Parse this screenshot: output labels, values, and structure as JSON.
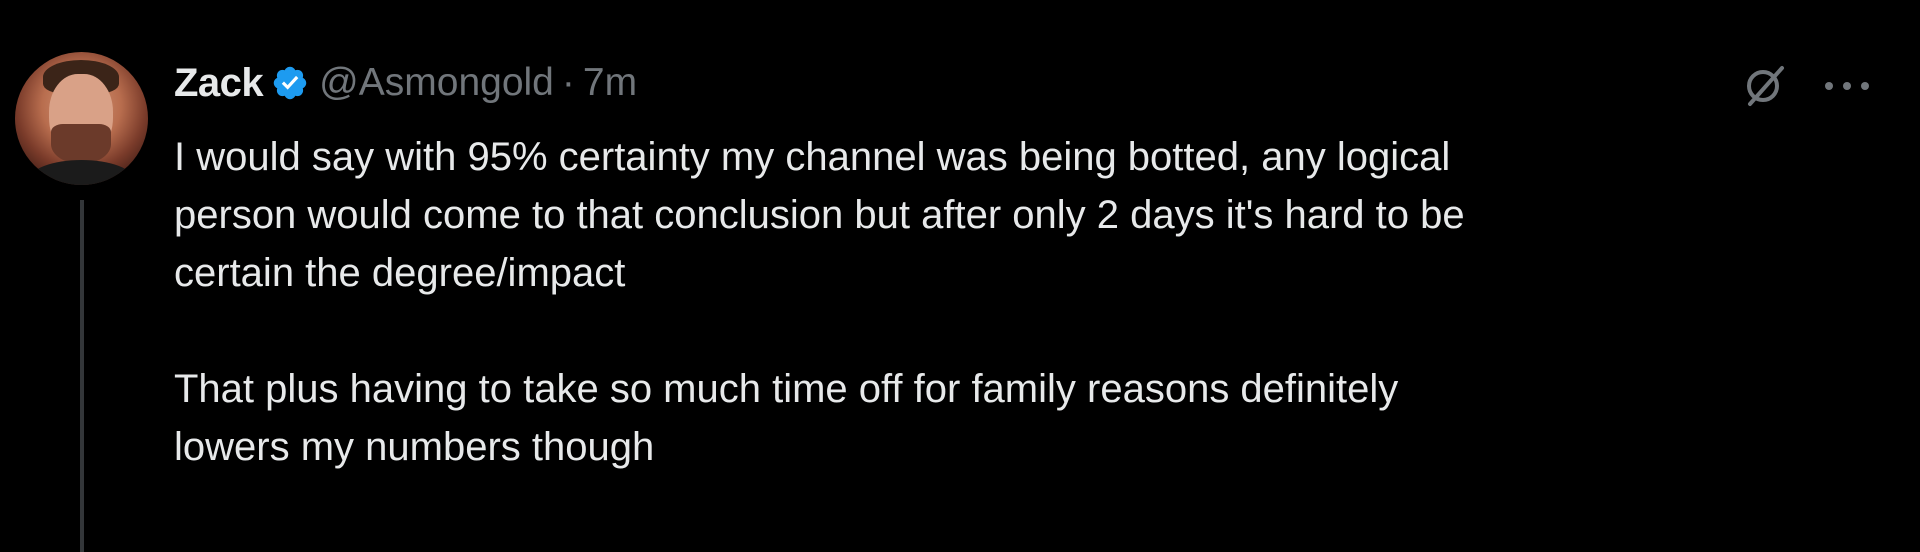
{
  "tweet": {
    "author_name": "Zack",
    "handle": "@Asmongold",
    "separator": "·",
    "time": "7m",
    "text_paragraphs": [
      [
        "I would say with 95% certainty my channel was being botted, any logical",
        "person would come to that conclusion but after only 2 days it's hard to be",
        "certain the degree/impact"
      ],
      [
        "That plus having to take so much time off for family reasons definitely",
        "lowers my numbers though"
      ]
    ]
  },
  "icons": {
    "verified": "verified-badge-icon",
    "grok": "grok-icon",
    "more": "more-options-icon"
  },
  "colors": {
    "background": "#000000",
    "text": "#e7e9ea",
    "secondary_text": "#71767b",
    "verified_blue": "#1d9bf0",
    "thread_line": "#333639"
  }
}
